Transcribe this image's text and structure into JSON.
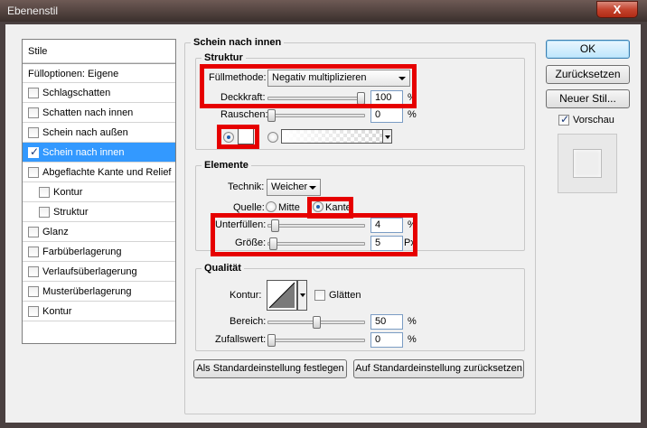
{
  "window": {
    "title": "Ebenenstil",
    "close_label": "X"
  },
  "style_list": {
    "header": "Stile",
    "blend_options": "Fülloptionen: Eigene",
    "items": [
      {
        "label": "Schlagschatten",
        "checked": false,
        "sub": false,
        "selected": false
      },
      {
        "label": "Schatten nach innen",
        "checked": false,
        "sub": false,
        "selected": false
      },
      {
        "label": "Schein nach außen",
        "checked": false,
        "sub": false,
        "selected": false
      },
      {
        "label": "Schein nach innen",
        "checked": true,
        "sub": false,
        "selected": true
      },
      {
        "label": "Abgeflachte Kante und Relief",
        "checked": false,
        "sub": false,
        "selected": false
      },
      {
        "label": "Kontur",
        "checked": false,
        "sub": true,
        "selected": false
      },
      {
        "label": "Struktur",
        "checked": false,
        "sub": true,
        "selected": false
      },
      {
        "label": "Glanz",
        "checked": false,
        "sub": false,
        "selected": false
      },
      {
        "label": "Farbüberlagerung",
        "checked": false,
        "sub": false,
        "selected": false
      },
      {
        "label": "Verlaufsüberlagerung",
        "checked": false,
        "sub": false,
        "selected": false
      },
      {
        "label": "Musterüberlagerung",
        "checked": false,
        "sub": false,
        "selected": false
      },
      {
        "label": "Kontur",
        "checked": false,
        "sub": false,
        "selected": false
      }
    ]
  },
  "panel": {
    "title": "Schein nach innen",
    "structure": {
      "title": "Struktur",
      "blend_mode_label": "Füllmethode:",
      "blend_mode_value": "Negativ multiplizieren",
      "opacity_label": "Deckkraft:",
      "opacity_value": "100",
      "opacity_fraction": 1.0,
      "noise_label": "Rauschen:",
      "noise_value": "0",
      "noise_fraction": 0.0,
      "percent": "%",
      "color_radio_on": true,
      "gradient_radio_on": false
    },
    "elements": {
      "title": "Elemente",
      "technique_label": "Technik:",
      "technique_value": "Weicher",
      "source_label": "Quelle:",
      "source_center": "Mitte",
      "source_edge": "Kante",
      "edge_selected": true,
      "choke_label": "Unterfüllen:",
      "choke_value": "4",
      "choke_fraction": 0.04,
      "size_label": "Größe:",
      "size_value": "5",
      "size_fraction": 0.02,
      "percent": "%",
      "px": "Px"
    },
    "quality": {
      "title": "Qualität",
      "contour_label": "Kontur:",
      "antialias_label": "Glätten",
      "antialias_checked": false,
      "range_label": "Bereich:",
      "range_value": "50",
      "range_fraction": 0.5,
      "jitter_label": "Zufallswert:",
      "jitter_value": "0",
      "jitter_fraction": 0.0,
      "percent": "%"
    },
    "make_default": "Als Standardeinstellung festlegen",
    "reset_default": "Auf Standardeinstellung zurücksetzen"
  },
  "buttons": {
    "ok": "OK",
    "reset": "Zurücksetzen",
    "new_style": "Neuer Stil...",
    "preview_label": "Vorschau",
    "preview_checked": true
  },
  "colors": {
    "highlight": "#e60000",
    "selection": "#3399ff",
    "glow_color": "#ffffff"
  }
}
